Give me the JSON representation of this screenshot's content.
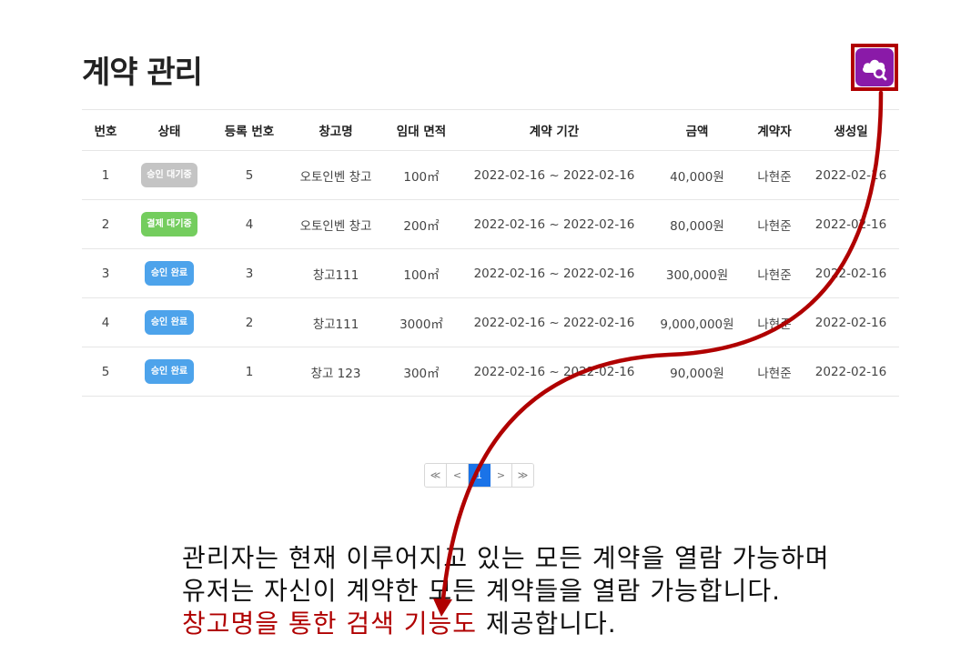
{
  "page": {
    "title": "계약 관리"
  },
  "table": {
    "headers": [
      "번호",
      "상태",
      "등록 번호",
      "창고명",
      "임대 면적",
      "계약 기간",
      "금액",
      "계약자",
      "생성일"
    ],
    "rows": [
      {
        "no": "1",
        "status": "승인 대기중",
        "status_color": "#c4c4c4",
        "reg_no": "5",
        "warehouse": "오토인벤 창고",
        "area": "100㎡",
        "period": "2022-02-16 ~ 2022-02-16",
        "amount": "40,000원",
        "contractor": "나현준",
        "created": "2022-02-16"
      },
      {
        "no": "2",
        "status": "결제 대기중",
        "status_color": "#74cd5e",
        "reg_no": "4",
        "warehouse": "오토인벤 창고",
        "area": "200㎡",
        "period": "2022-02-16 ~ 2022-02-16",
        "amount": "80,000원",
        "contractor": "나현준",
        "created": "2022-02-16"
      },
      {
        "no": "3",
        "status": "승인 완료",
        "status_color": "#4da3eb",
        "reg_no": "3",
        "warehouse": "창고111",
        "area": "100㎡",
        "period": "2022-02-16 ~ 2022-02-16",
        "amount": "300,000원",
        "contractor": "나현준",
        "created": "2022-02-16"
      },
      {
        "no": "4",
        "status": "승인 완료",
        "status_color": "#4da3eb",
        "reg_no": "2",
        "warehouse": "창고111",
        "area": "3000㎡",
        "period": "2022-02-16 ~ 2022-02-16",
        "amount": "9,000,000원",
        "contractor": "나현준",
        "created": "2022-02-16"
      },
      {
        "no": "5",
        "status": "승인 완료",
        "status_color": "#4da3eb",
        "reg_no": "1",
        "warehouse": "창고 123",
        "area": "300㎡",
        "period": "2022-02-16 ~ 2022-02-16",
        "amount": "90,000원",
        "contractor": "나현준",
        "created": "2022-02-16"
      }
    ]
  },
  "pagination": {
    "first": "≪",
    "prev": "<",
    "current": "1",
    "next": ">",
    "last": "≫"
  },
  "icons": {
    "search": "cloud-search-icon"
  },
  "colors": {
    "accent": "#8a1aa8",
    "highlight": "#b00000",
    "page_active": "#1a73e8"
  },
  "description": {
    "line1": "관리자는 현재 이루어지고 있는 모든 계약을 열람 가능하며",
    "line2": "유저는 자신이 계약한 모든 계약들을 열람 가능합니다.",
    "line3_highlight": "창고명을 통한 검색 기능도",
    "line3_rest": " 제공합니다."
  }
}
